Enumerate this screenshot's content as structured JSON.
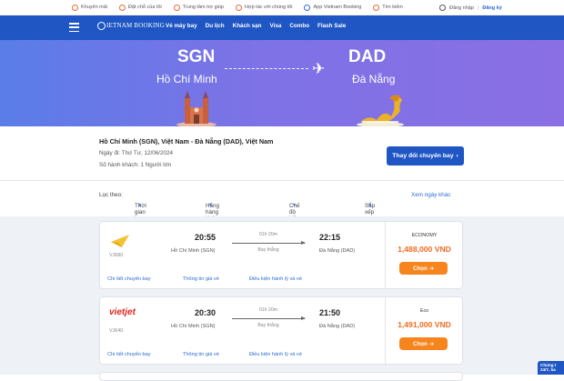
{
  "topbar": {
    "items": [
      {
        "label": "Khuyến mãi",
        "icon": "promo-icon"
      },
      {
        "label": "Đặt chỗ của tôi",
        "icon": "booking-icon"
      },
      {
        "label": "Trung tâm trợ giúp",
        "icon": "help-icon"
      },
      {
        "label": "Hợp tác với chúng tôi",
        "icon": "partner-icon"
      },
      {
        "label": "App Vietnam Booking",
        "icon": "app-icon"
      },
      {
        "label": "Tìm kiếm",
        "icon": "search-icon"
      }
    ],
    "login": "Đăng nhập",
    "register": "Đăng ký"
  },
  "nav": {
    "logo": "IETNAM BOOKING",
    "menu": [
      "Vé máy bay",
      "Du lịch",
      "Khách sạn",
      "Visa",
      "Combo",
      "Flash Sale"
    ]
  },
  "hero": {
    "from_code": "SGN",
    "from_city": "Hồ Chí Minh",
    "to_code": "DAD",
    "to_city": "Đà Nẵng",
    "plane_icon": "airplane-icon"
  },
  "trip": {
    "route": "Hồ Chí Minh (SGN), Việt Nam - Đà Nẵng (DAD), Việt Nam",
    "date": "Ngày đi: Thứ Tư, 12/06/2024",
    "passengers": "Số hành khách: 1 Người lớn",
    "change_button": "Thay đổi chuyến bay"
  },
  "filters": {
    "label": "Lọc theo:",
    "options": [
      "Thời gian bay",
      "Hãng hàng không",
      "Chế độ hiện thị",
      "Sắp xếp"
    ],
    "more": "Xem ngày khác"
  },
  "flights": [
    {
      "airline_logo": "vietnam-airlines-logo",
      "flight_no": "VJ680",
      "dep_time": "20:55",
      "dep_city": "Hồ Chí Minh (SGN)",
      "duration": "01h 20m",
      "type": "Bay thẳng",
      "arr_time": "22:15",
      "arr_city": "Đà Nẵng (DAD)",
      "class": "ECONOMY",
      "price": "1,488,000 VND",
      "select": "Chọn",
      "link_detail": "Chi tiết chuyến bay",
      "link_price": "Thông tin giá vé",
      "link_terms": "Điều kiện hành lý và vé"
    },
    {
      "airline_logo": "vietjet-logo",
      "airline_name": "vietjet",
      "flight_no": "VJ640",
      "dep_time": "20:30",
      "dep_city": "Hồ Chí Minh (SGN)",
      "duration": "01h 20m",
      "type": "Bay thẳng",
      "arr_time": "21:50",
      "arr_city": "Đà Nẵng (DAD)",
      "class": "Eco",
      "price": "1,491,000 VND",
      "select": "Chọn",
      "link_detail": "Chi tiết chuyến bay",
      "link_price": "Thông tin giá vé",
      "link_terms": "Điều kiện hành lý và vé"
    }
  ],
  "chat": {
    "line1": "Chúng t",
    "line2": "24/7, ba"
  }
}
